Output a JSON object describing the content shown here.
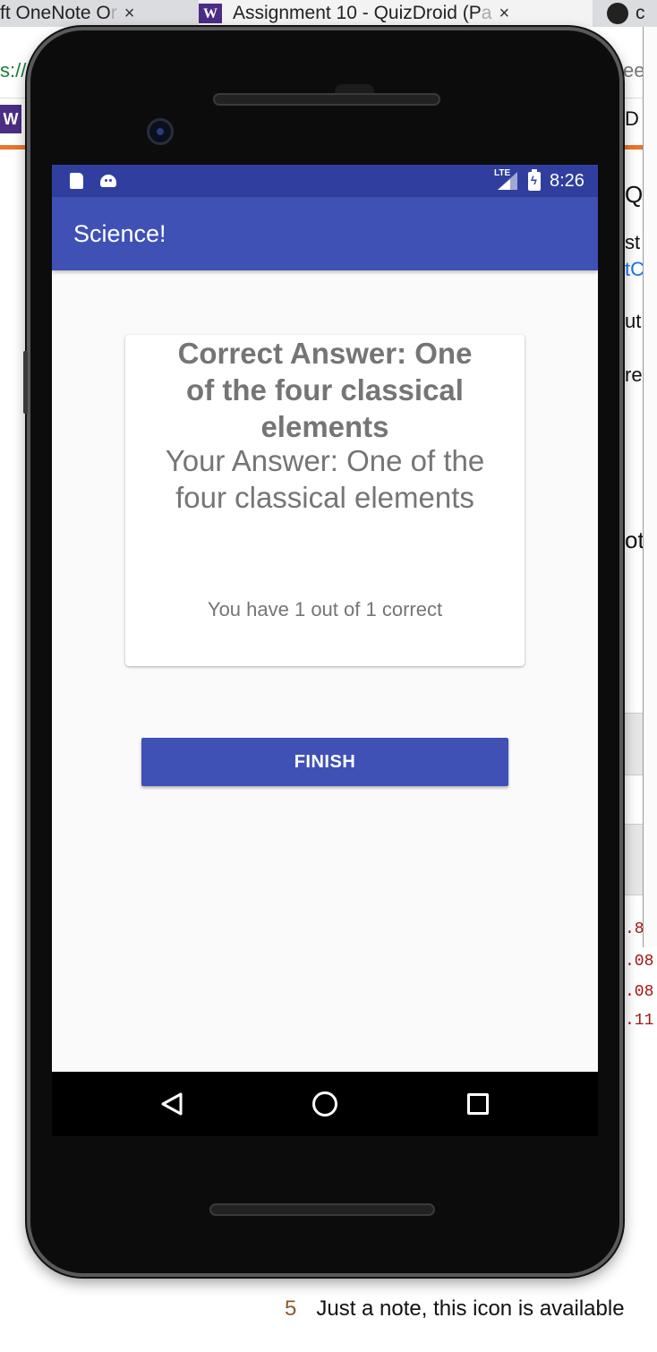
{
  "browser": {
    "tabs": [
      {
        "label": "ft OneNote O",
        "label_faded": "r"
      },
      {
        "label": "Assignment 10 - QuizDroid (P",
        "label_faded": "a"
      },
      {
        "label": "c"
      }
    ],
    "tab_close": "×",
    "tab_w_icon": "W",
    "url_fragment": "s://",
    "url_right_fragment": "ee",
    "page_w_icon": "W",
    "right_fragments": [
      "D T",
      "Qu",
      "st g",
      "tCl",
      "ut i",
      "re",
      "ot"
    ],
    "right_code": [
      ".8",
      ".08",
      ".08",
      ".11"
    ],
    "note_number": "5",
    "note_text": "Just a note, this icon is available"
  },
  "phone": {
    "status_bar": {
      "lte": "LTE",
      "time": "8:26",
      "icons": [
        "sd-card-icon",
        "android-icon",
        "signal-icon",
        "battery-charging-icon"
      ]
    },
    "app_bar": {
      "title": "Science!"
    },
    "card": {
      "correct_answer": "Correct Answer: One of the four classical elements",
      "your_answer": "Your Answer: One of the four classical elements",
      "score": "You have 1 out of 1 correct"
    },
    "finish_button": "FINISH",
    "nav_icons": [
      "back-icon",
      "home-icon",
      "recents-icon"
    ]
  },
  "colors": {
    "primary": "#3f51b5",
    "primary_dark": "#303f9f",
    "card_text": "#757575",
    "screen_bg": "#fafafa"
  }
}
